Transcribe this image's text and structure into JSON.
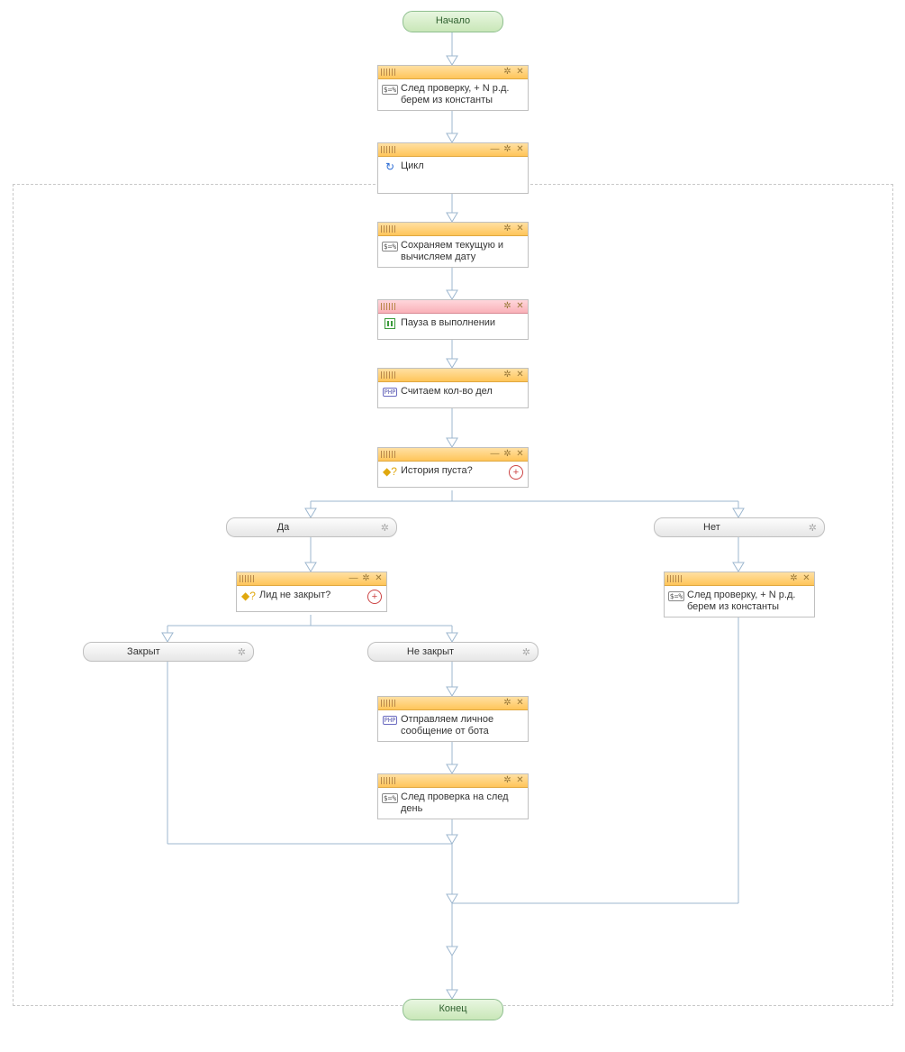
{
  "terminals": {
    "start": "Начало",
    "end": "Конец"
  },
  "nodes": {
    "n1": "След проверку, + N р.д. берем из константы",
    "n2": "Цикл",
    "n3": "Сохраняем текущую и вычисляем дату",
    "n4": "Пауза в выполнении",
    "n5": "Считаем кол-во дел",
    "n6": "История пуста?",
    "n7": "Лид не закрыт?",
    "n8": "След проверку, + N р.д. берем из константы",
    "n9": "Отправляем личное сообщение от бота",
    "n10": "След проверка на след день"
  },
  "branches": {
    "yes": "Да",
    "no": "Нет",
    "closed": "Закрыт",
    "notclosed": "Не закрыт"
  },
  "controls": {
    "minimize": "—",
    "gear": "✲",
    "close": "✕",
    "add": "+"
  },
  "icons": {
    "var": "$=%",
    "php": "PHP",
    "loop": "↻",
    "cond": "◆?"
  }
}
